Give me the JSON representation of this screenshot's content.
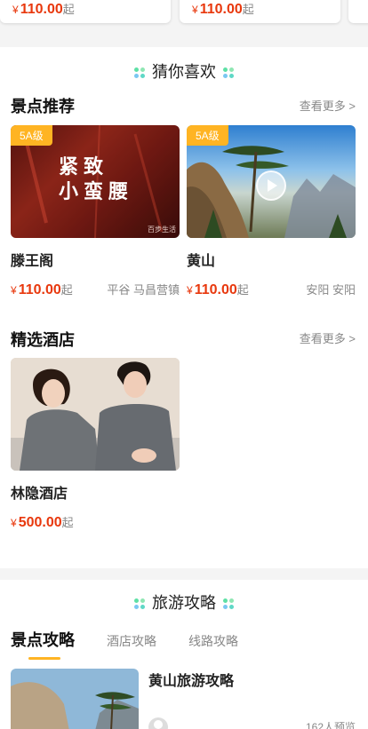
{
  "top_cards": [
    {
      "currency": "¥",
      "price": "110.00",
      "unit": "起"
    },
    {
      "currency": "¥",
      "price": "110.00",
      "unit": "起"
    }
  ],
  "guess": {
    "title": "猜你喜欢"
  },
  "scenic": {
    "heading": "景点推荐",
    "more": "查看更多 >",
    "items": [
      {
        "badge": "5A级",
        "name": "滕王阁",
        "currency": "¥",
        "price": "110.00",
        "unit": "起",
        "location": "平谷 马昌营镇",
        "image_text_line1": "紧致",
        "image_text_line2": "小蛮腰",
        "image_caption": "百步生活"
      },
      {
        "badge": "5A级",
        "name": "黄山",
        "currency": "¥",
        "price": "110.00",
        "unit": "起",
        "location": "安阳 安阳"
      }
    ]
  },
  "hotels": {
    "heading": "精选酒店",
    "more": "查看更多 >",
    "items": [
      {
        "name": "林隐酒店",
        "currency": "¥",
        "price": "500.00",
        "unit": "起"
      }
    ]
  },
  "travel": {
    "title": "旅游攻略",
    "tabs": [
      "景点攻略",
      "酒店攻略",
      "线路攻略"
    ],
    "active_tab": 0,
    "guide": {
      "title": "黄山旅游攻略",
      "views": "162人预览"
    }
  },
  "colors": {
    "price": "#e8380d",
    "accent": "#ffb423"
  }
}
